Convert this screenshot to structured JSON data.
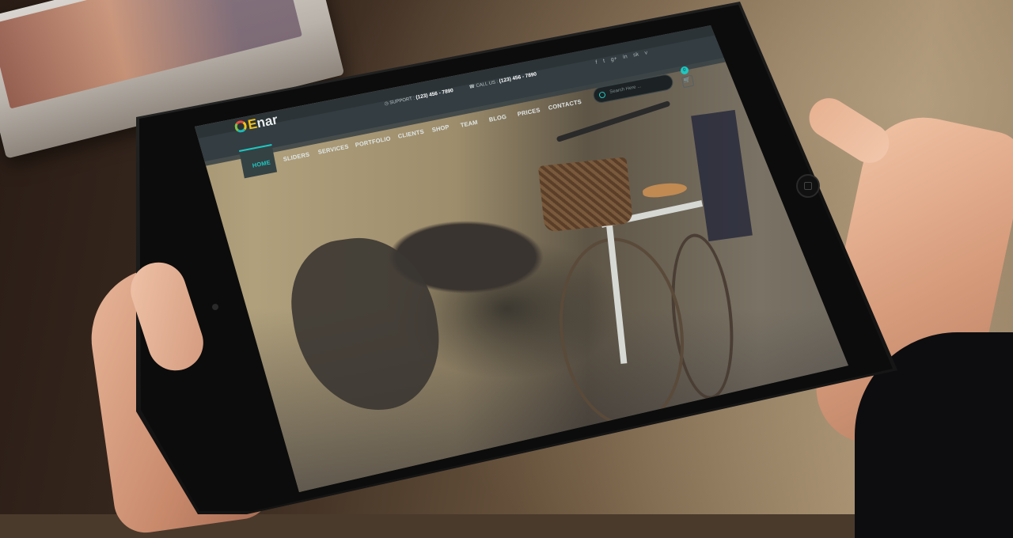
{
  "site": {
    "logo": {
      "letter": "E",
      "text": "nar"
    },
    "topbar": {
      "support_label": "SUPPORT :",
      "support_phone": "(123) 456 - 7890",
      "call_label": "CALL US :",
      "call_phone": "(123) 456 - 7890"
    },
    "search": {
      "placeholder": "Search Here ..."
    },
    "social": [
      "f",
      "t",
      "g+",
      "in",
      "sk",
      "v"
    ],
    "cart": {
      "count": "0"
    },
    "nav": [
      {
        "label": "HOME",
        "active": true
      },
      {
        "label": "SLIDERS"
      },
      {
        "label": "SERVICES"
      },
      {
        "label": "PORTFOLIO"
      },
      {
        "label": "CLIENTS"
      },
      {
        "label": "SHOP"
      },
      {
        "label": "TEAM"
      },
      {
        "label": "BLOG"
      },
      {
        "label": "PRICES"
      },
      {
        "label": "CONTACTS"
      }
    ]
  },
  "colors": {
    "accent": "#1fc7c1",
    "header_dark": "#23292b",
    "nav_bg": "#2c3336"
  }
}
